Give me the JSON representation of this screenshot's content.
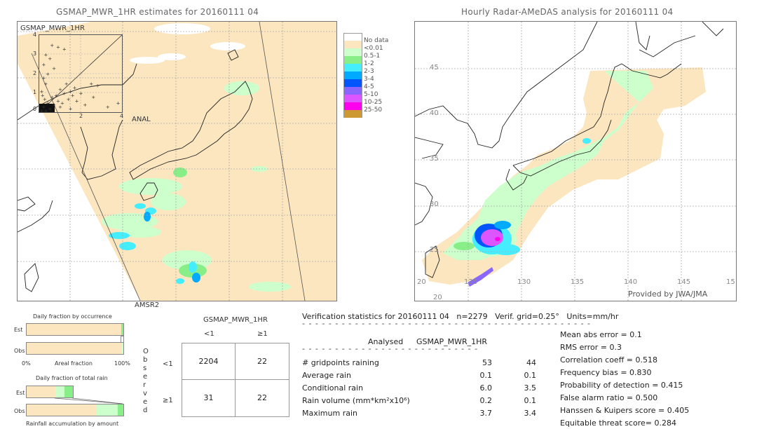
{
  "chart_data": [
    {
      "type": "heatmap",
      "title": "GSMAP_MWR_1HR estimates for 20160111 04",
      "sensor_label": "AMSR2",
      "inset_scatter": {
        "type": "scatter",
        "ylabel": "GSMAP_MWR_1HR",
        "xlabel": "ANAL",
        "xlim": [
          0,
          4
        ],
        "ylim": [
          0,
          4
        ],
        "x_ticks": [
          "0",
          "2",
          "4"
        ],
        "y_ticks": [
          "0",
          "1",
          "2",
          "3",
          "4"
        ],
        "points": [
          [
            0.1,
            0.1
          ],
          [
            0.2,
            0.3
          ],
          [
            0.3,
            0.1
          ],
          [
            0.4,
            0.5
          ],
          [
            0.5,
            0.2
          ],
          [
            0.6,
            0.8
          ],
          [
            0.7,
            0.4
          ],
          [
            0.8,
            0.9
          ],
          [
            0.9,
            0.6
          ],
          [
            1.0,
            1.2
          ],
          [
            1.1,
            0.5
          ],
          [
            1.2,
            1.0
          ],
          [
            1.3,
            1.5
          ],
          [
            1.4,
            0.7
          ],
          [
            1.5,
            1.1
          ],
          [
            1.6,
            0.9
          ],
          [
            1.7,
            1.3
          ],
          [
            1.8,
            0.6
          ],
          [
            2.0,
            1.0
          ],
          [
            2.2,
            0.4
          ],
          [
            0.2,
            2.5
          ],
          [
            0.3,
            3.0
          ],
          [
            0.5,
            2.8
          ],
          [
            0.6,
            3.5
          ],
          [
            0.9,
            3.4
          ],
          [
            1.2,
            3.3
          ],
          [
            0.4,
            2.0
          ],
          [
            0.7,
            2.3
          ],
          [
            0.2,
            1.8
          ],
          [
            0.3,
            1.5
          ],
          [
            2.5,
            1.5
          ],
          [
            2.8,
            1.4
          ],
          [
            3.3,
            0.3
          ],
          [
            3.8,
            0.5
          ],
          [
            2.6,
            0.8
          ],
          [
            0.1,
            1.1
          ],
          [
            0.15,
            0.9
          ],
          [
            0.25,
            0.7
          ],
          [
            1.0,
            0.3
          ],
          [
            1.5,
            0.2
          ]
        ]
      },
      "colorbar": {
        "labels": [
          "No data",
          "<0.01",
          "0.5-1",
          "1-2",
          "2-3",
          "3-4",
          "4-5",
          "5-10",
          "10-25",
          "25-50"
        ],
        "colors": [
          "#ffffff",
          "#fce6bf",
          "#ccffcc",
          "#88ee88",
          "#44eeff",
          "#00aaff",
          "#0055ff",
          "#8866ff",
          "#dd55ff",
          "#ff00ee",
          "#cc9933"
        ]
      }
    },
    {
      "type": "heatmap",
      "title": "Hourly Radar-AMeDAS analysis for 20160111 04",
      "x_ticks": [
        "20",
        "125",
        "130",
        "135",
        "140",
        "145",
        "15"
      ],
      "y_ticks": [
        "45",
        "40",
        "35",
        "30",
        "25",
        "20"
      ],
      "credit": "Provided by JWA/JMA"
    },
    {
      "type": "bar",
      "title": "Daily fraction by occurrence",
      "xlabel": "Areal fraction",
      "x_ticks": [
        "0%",
        "100%"
      ],
      "categories": [
        "Est",
        "Obs"
      ],
      "series": [
        {
          "name": "<0.01",
          "values": [
            0.98,
            0.98
          ]
        },
        {
          "name": "0.5-1",
          "values": [
            0.02,
            0.02
          ]
        }
      ]
    },
    {
      "type": "bar",
      "title": "Daily fraction of total rain",
      "xlabel": "Rainfall accumulation by amount",
      "categories": [
        "Est",
        "Obs"
      ],
      "series": [
        {
          "name": "<0.01",
          "values": [
            0.62,
            0.72
          ]
        },
        {
          "name": "0.5-1",
          "values": [
            0.19,
            0.22
          ]
        },
        {
          "name": "1-2",
          "values": [
            0.19,
            0.06
          ]
        }
      ],
      "est_total_fraction_of_obs": 0.48
    },
    {
      "type": "table",
      "title": "GSMAP_MWR_1HR",
      "row_axis_label": "Observed",
      "col_headers": [
        "<1",
        "≥1"
      ],
      "row_headers": [
        "<1",
        "≥1"
      ],
      "cells": [
        [
          "2204",
          "22"
        ],
        [
          "31",
          "22"
        ]
      ]
    }
  ],
  "stats": {
    "header": "Verification statistics for 20160111 04   n=2279   Verif. grid=0.25°   Units=mm/hr",
    "col_analysed": "Analysed",
    "col_est": "GSMAP_MWR_1HR",
    "rows": [
      {
        "label": "# gridpoints raining",
        "analysed": "53",
        "est": "44"
      },
      {
        "label": "Average rain",
        "analysed": "0.1",
        "est": "0.1"
      },
      {
        "label": "Conditional rain",
        "analysed": "6.0",
        "est": "3.5"
      },
      {
        "label": "Rain volume (mm*km²x10⁶)",
        "analysed": "0.2",
        "est": "0.1"
      },
      {
        "label": "Maximum rain",
        "analysed": "3.7",
        "est": "3.4"
      }
    ],
    "scores": [
      "Mean abs error = 0.1",
      "RMS error = 0.3",
      "Correlation coeff = 0.518",
      "Frequency bias = 0.830",
      "Probability of detection = 0.415",
      "False alarm ratio = 0.500",
      "Hanssen & Kuipers score = 0.405",
      "Equitable threat score= 0.284"
    ]
  }
}
